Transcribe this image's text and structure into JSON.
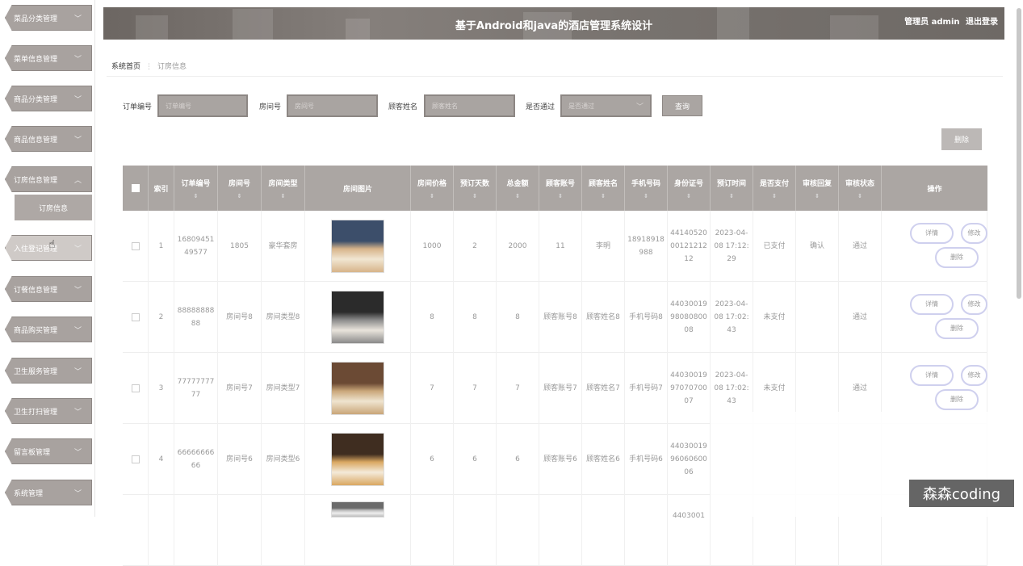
{
  "sidebar": {
    "items": [
      {
        "label": "菜品分类管理"
      },
      {
        "label": "菜单信息管理"
      },
      {
        "label": "商品分类管理"
      },
      {
        "label": "商品信息管理"
      },
      {
        "label": "订房信息管理",
        "expanded": true
      },
      {
        "label": "入住登记管理"
      },
      {
        "label": "订餐信息管理"
      },
      {
        "label": "商品购买管理"
      },
      {
        "label": "卫生服务管理"
      },
      {
        "label": "卫生打扫管理"
      },
      {
        "label": "留言板管理"
      },
      {
        "label": "系统管理"
      }
    ],
    "sub_item": "订房信息"
  },
  "header": {
    "title": "基于Android和java的酒店管理系统设计",
    "user": "管理员 admin",
    "logout": "退出登录"
  },
  "breadcrumb": {
    "home": "系统首页",
    "sep": "⋮",
    "current": "订房信息"
  },
  "search": {
    "order_no_label": "订单编号",
    "order_no_placeholder": "订单编号",
    "room_no_label": "房间号",
    "room_no_placeholder": "房间号",
    "guest_label": "顾客姓名",
    "guest_placeholder": "顾客姓名",
    "approved_label": "是否通过",
    "approved_placeholder": "是否通过",
    "query_button": "查询"
  },
  "delete_button": "删除",
  "table": {
    "headers": [
      "索引",
      "订单编号",
      "房间号",
      "房间类型",
      "房间图片",
      "房间价格",
      "预订天数",
      "总金额",
      "顾客账号",
      "顾客姓名",
      "手机号码",
      "身份证号",
      "预订时间",
      "是否支付",
      "审核回复",
      "审核状态",
      "操作"
    ],
    "rows": [
      {
        "idx": "1",
        "order": "1680945149577",
        "room": "1805",
        "type": "豪华套房",
        "price": "1000",
        "days": "2",
        "total": "2000",
        "account": "11",
        "name": "李明",
        "phone": "18918918988",
        "id": "441405200012121212",
        "time": "2023-04-08 17:12:29",
        "paid": "已支付",
        "reply": "确认",
        "status": "通过"
      },
      {
        "idx": "2",
        "order": "8888888888",
        "room": "房间号8",
        "type": "房间类型8",
        "price": "8",
        "days": "8",
        "total": "8",
        "account": "顾客账号8",
        "name": "顾客姓名8",
        "phone": "手机号码8",
        "id": "440300199808080008",
        "time": "2023-04-08 17:02:43",
        "paid": "未支付",
        "reply": "",
        "status": "通过"
      },
      {
        "idx": "3",
        "order": "7777777777",
        "room": "房间号7",
        "type": "房间类型7",
        "price": "7",
        "days": "7",
        "total": "7",
        "account": "顾客账号7",
        "name": "顾客姓名7",
        "phone": "手机号码7",
        "id": "440300199707070007",
        "time": "2023-04-08 17:02:43",
        "paid": "未支付",
        "reply": "",
        "status": "通过"
      },
      {
        "idx": "4",
        "order": "6666666666",
        "room": "房间号6",
        "type": "房间类型6",
        "price": "6",
        "days": "6",
        "total": "6",
        "account": "顾客账号6",
        "name": "顾客姓名6",
        "phone": "手机号码6",
        "id": "440300199606060006",
        "time": "",
        "paid": "",
        "reply": "",
        "status": ""
      },
      {
        "idx": "",
        "order": "",
        "room": "",
        "type": "",
        "price": "",
        "days": "",
        "total": "",
        "account": "",
        "name": "",
        "phone": "",
        "id": "4403001",
        "time": "",
        "paid": "",
        "reply": "",
        "status": ""
      }
    ],
    "actions": {
      "detail": "详情",
      "edit": "修改",
      "delete": "删除"
    }
  },
  "watermark": "森森coding",
  "colors": {
    "primary": "#a9a4a1",
    "header": "#77726e",
    "action_border": "#cfd0ee"
  }
}
